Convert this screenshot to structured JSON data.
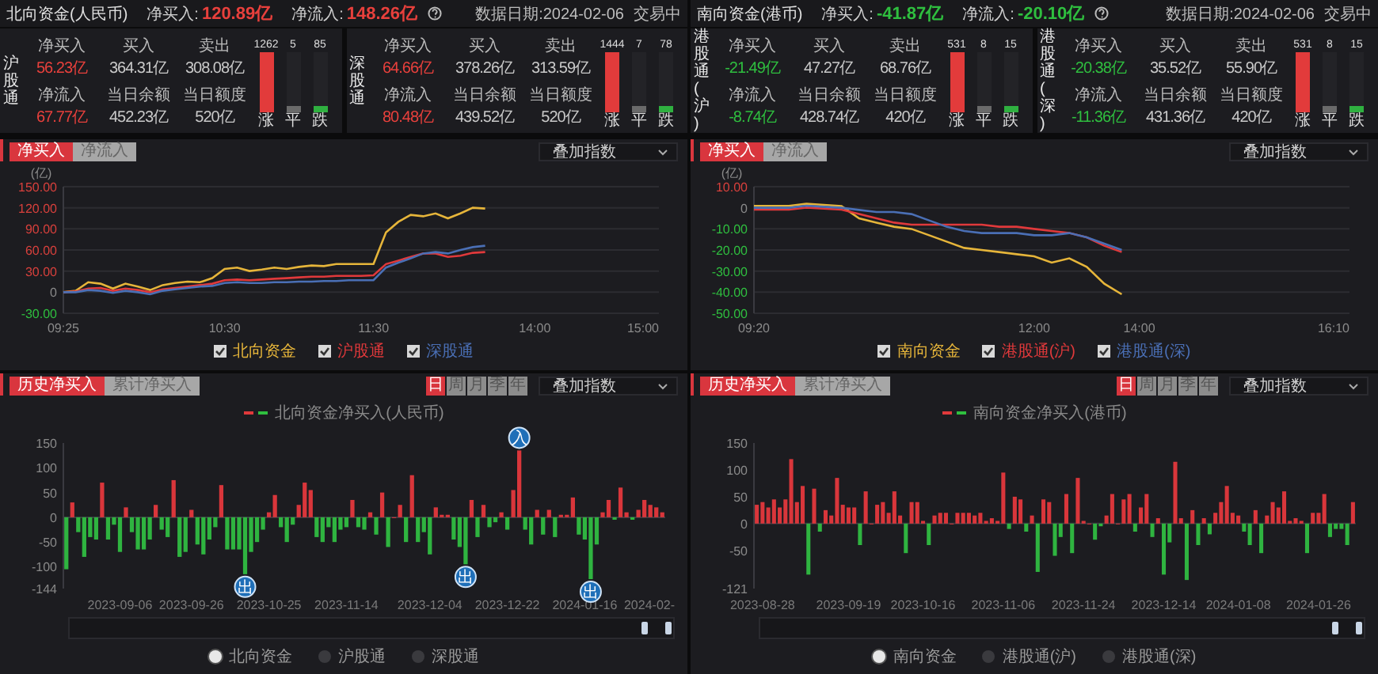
{
  "panels": [
    {
      "header": {
        "title": "北向资金(人民币)",
        "net_buy": {
          "label": "净买入:",
          "value": "120.89亿",
          "color": "#e8403c"
        },
        "net_inflow": {
          "label": "净流入:",
          "value": "148.26亿",
          "color": "#e8403c"
        },
        "date": "数据日期:2024-02-06",
        "status": "交易中"
      },
      "channels": [
        {
          "name": "沪股通",
          "stats": [
            {
              "label": "净买入",
              "value": "56.23亿",
              "color": "#e8403c"
            },
            {
              "label": "买入",
              "value": "364.31亿",
              "color": "#c9c9c9"
            },
            {
              "label": "卖出",
              "value": "308.08亿",
              "color": "#c9c9c9"
            },
            {
              "label": "净流入",
              "value": "67.77亿",
              "color": "#e8403c"
            },
            {
              "label": "当日余额",
              "value": "452.23亿",
              "color": "#c9c9c9"
            },
            {
              "label": "当日额度",
              "value": "520亿",
              "color": "#c9c9c9"
            }
          ],
          "breadth": [
            {
              "kind": "up",
              "count": "1262",
              "label": "涨",
              "level": 1
            },
            {
              "kind": "flat",
              "count": "5",
              "label": "平",
              "level": 0.1
            },
            {
              "kind": "down",
              "count": "85",
              "label": "跌",
              "level": 0.1
            }
          ]
        },
        {
          "name": "深股通",
          "stats": [
            {
              "label": "净买入",
              "value": "64.66亿",
              "color": "#e8403c"
            },
            {
              "label": "买入",
              "value": "378.26亿",
              "color": "#c9c9c9"
            },
            {
              "label": "卖出",
              "value": "313.59亿",
              "color": "#c9c9c9"
            },
            {
              "label": "净流入",
              "value": "80.48亿",
              "color": "#e8403c"
            },
            {
              "label": "当日余额",
              "value": "439.52亿",
              "color": "#c9c9c9"
            },
            {
              "label": "当日额度",
              "value": "520亿",
              "color": "#c9c9c9"
            }
          ],
          "breadth": [
            {
              "kind": "up",
              "count": "1444",
              "label": "涨",
              "level": 1
            },
            {
              "kind": "flat",
              "count": "7",
              "label": "平",
              "level": 0.1
            },
            {
              "kind": "down",
              "count": "78",
              "label": "跌",
              "level": 0.1
            }
          ]
        }
      ],
      "intraday": {
        "tabs": [
          {
            "label": "净买入",
            "selected": true
          },
          {
            "label": "净流入",
            "selected": false
          }
        ],
        "dropdown": "叠加指数",
        "chart_data": {
          "type": "line",
          "ylabel": "(亿)",
          "grid": true,
          "ylim": [
            -30,
            150
          ],
          "categories": [
            "09:25",
            null,
            null,
            null,
            null,
            null,
            null,
            null,
            null,
            null,
            null,
            null,
            null,
            "10:30",
            null,
            null,
            null,
            null,
            null,
            null,
            null,
            null,
            null,
            null,
            null,
            "11:30",
            null,
            null,
            null,
            null,
            null,
            null,
            null,
            null,
            null,
            null,
            null,
            null,
            "14:00",
            null,
            null,
            null,
            null,
            null,
            null,
            null,
            null,
            null,
            "15:00"
          ],
          "yticks": [
            {
              "value": -30,
              "label": "-30.00"
            },
            {
              "value": 0,
              "label": "0"
            },
            {
              "value": 30,
              "label": "30.00"
            },
            {
              "value": 60,
              "label": "60.00"
            },
            {
              "value": 90,
              "label": "90.00"
            },
            {
              "value": 120,
              "label": "120.00"
            },
            {
              "value": 150,
              "label": "150.00"
            }
          ],
          "series": [
            {
              "name": "北向资金",
              "color": "#e6b53a",
              "values": [
                0,
                2,
                14,
                12,
                5,
                12,
                8,
                3,
                10,
                13,
                15,
                14,
                20,
                33,
                35,
                30,
                32,
                35,
                33,
                36,
                38,
                37,
                40,
                40,
                40,
                40,
                85,
                100,
                110,
                108,
                112,
                105,
                112,
                120,
                119,
                null,
                null,
                null,
                null,
                null,
                null,
                null,
                null,
                null,
                null,
                null,
                null,
                null,
                null
              ]
            },
            {
              "name": "沪股通",
              "color": "#e0393b",
              "values": [
                0,
                1,
                5,
                6,
                2,
                5,
                3,
                0,
                4,
                6,
                8,
                10,
                12,
                17,
                18,
                17,
                18,
                19,
                20,
                21,
                22,
                22,
                23,
                23,
                23,
                24,
                40,
                45,
                50,
                55,
                55,
                50,
                52,
                56,
                57,
                null,
                null,
                null,
                null,
                null,
                null,
                null,
                null,
                null,
                null,
                null,
                null,
                null,
                null
              ]
            },
            {
              "name": "深股通",
              "color": "#4a6fb5",
              "values": [
                0,
                0,
                3,
                2,
                -1,
                2,
                0,
                -3,
                2,
                4,
                6,
                8,
                9,
                13,
                14,
                13,
                13,
                14,
                14,
                15,
                15,
                16,
                16,
                17,
                17,
                17,
                35,
                42,
                48,
                55,
                57,
                55,
                60,
                64,
                66,
                null,
                null,
                null,
                null,
                null,
                null,
                null,
                null,
                null,
                null,
                null,
                null,
                null,
                null
              ]
            }
          ]
        },
        "legend": [
          {
            "checked": true
          },
          {
            "checked": true
          },
          {
            "checked": true
          }
        ]
      },
      "history": {
        "tabs": [
          {
            "label": "历史净买入",
            "selected": true
          },
          {
            "label": "累计净买入",
            "selected": false
          }
        ],
        "periods": [
          {
            "label": "日",
            "selected": true
          },
          {
            "label": "周",
            "selected": false
          },
          {
            "label": "月",
            "selected": false
          },
          {
            "label": "季",
            "selected": false
          },
          {
            "label": "年",
            "selected": false
          }
        ],
        "dropdown": "叠加指数",
        "chart_data": {
          "type": "bar",
          "title": "北向资金净买入(人民币)",
          "ylim": [
            -144,
            150
          ],
          "yticks": [
            -144,
            -100,
            -50,
            0,
            50,
            100,
            150
          ],
          "categories": [
            null,
            null,
            null,
            null,
            null,
            null,
            null,
            null,
            null,
            "2023-09-06",
            null,
            null,
            null,
            null,
            null,
            null,
            null,
            null,
            null,
            null,
            null,
            "2023-09-26",
            null,
            null,
            null,
            null,
            null,
            null,
            null,
            null,
            null,
            null,
            null,
            null,
            "2023-10-25",
            null,
            null,
            null,
            null,
            null,
            null,
            null,
            null,
            null,
            null,
            null,
            null,
            "2023-11-14",
            null,
            null,
            null,
            null,
            null,
            null,
            null,
            null,
            null,
            null,
            null,
            null,
            null,
            "2023-12-04",
            null,
            null,
            null,
            null,
            null,
            null,
            null,
            null,
            null,
            null,
            null,
            null,
            "2023-12-22",
            null,
            null,
            null,
            null,
            null,
            null,
            null,
            null,
            null,
            null,
            null,
            null,
            "2024-01-16",
            null,
            null,
            null,
            null,
            null,
            null,
            null,
            null,
            null,
            null,
            "2024-02-",
            null,
            null
          ],
          "values": [
            -105,
            30,
            -30,
            -80,
            -40,
            -45,
            70,
            -45,
            -15,
            -70,
            20,
            -30,
            -65,
            -65,
            -45,
            25,
            -25,
            -40,
            75,
            -80,
            -70,
            15,
            -55,
            -75,
            -45,
            -20,
            65,
            -65,
            -65,
            -65,
            -115,
            -70,
            -50,
            -25,
            10,
            45,
            -20,
            -50,
            -15,
            25,
            70,
            55,
            -40,
            -50,
            -20,
            -50,
            -25,
            -20,
            35,
            -20,
            -25,
            10,
            -35,
            50,
            -60,
            0,
            25,
            -50,
            85,
            -50,
            -30,
            -75,
            20,
            5,
            5,
            -45,
            -60,
            -95,
            35,
            -40,
            25,
            -20,
            -10,
            10,
            -25,
            55,
            135,
            -25,
            -55,
            15,
            -35,
            15,
            -40,
            5,
            5,
            40,
            -35,
            -45,
            -125,
            -55,
            10,
            35,
            -5,
            60,
            10,
            -5,
            15,
            35,
            25,
            20,
            10
          ],
          "annotations": [
            {
              "y": -115,
              "text": "出"
            },
            {
              "y": -95,
              "text": "出"
            },
            {
              "y": 135,
              "text": "入"
            },
            {
              "y": -125,
              "text": "出"
            }
          ]
        },
        "series_options": [
          {
            "label": "北向资金",
            "selected": true
          },
          {
            "label": "沪股通",
            "selected": false
          },
          {
            "label": "深股通",
            "selected": false
          }
        ]
      }
    },
    {
      "header": {
        "title": "南向资金(港币)",
        "net_buy": {
          "label": "净买入:",
          "value": "-41.87亿",
          "color": "#2fbf3f"
        },
        "net_inflow": {
          "label": "净流入:",
          "value": "-20.10亿",
          "color": "#2fbf3f"
        },
        "date": "数据日期:2024-02-06",
        "status": "交易中"
      },
      "channels": [
        {
          "name": "港股通(沪)",
          "stats": [
            {
              "label": "净买入",
              "value": "-21.49亿",
              "color": "#2fbf3f"
            },
            {
              "label": "买入",
              "value": "47.27亿",
              "color": "#c9c9c9"
            },
            {
              "label": "卖出",
              "value": "68.76亿",
              "color": "#c9c9c9"
            },
            {
              "label": "净流入",
              "value": "-8.74亿",
              "color": "#2fbf3f"
            },
            {
              "label": "当日余额",
              "value": "428.74亿",
              "color": "#c9c9c9"
            },
            {
              "label": "当日额度",
              "value": "420亿",
              "color": "#c9c9c9"
            }
          ],
          "breadth": [
            {
              "kind": "up",
              "count": "531",
              "label": "涨",
              "level": 1
            },
            {
              "kind": "flat",
              "count": "8",
              "label": "平",
              "level": 0.1
            },
            {
              "kind": "down",
              "count": "15",
              "label": "跌",
              "level": 0.1
            }
          ]
        },
        {
          "name": "港股通(深)",
          "stats": [
            {
              "label": "净买入",
              "value": "-20.38亿",
              "color": "#2fbf3f"
            },
            {
              "label": "买入",
              "value": "35.52亿",
              "color": "#c9c9c9"
            },
            {
              "label": "卖出",
              "value": "55.90亿",
              "color": "#c9c9c9"
            },
            {
              "label": "净流入",
              "value": "-11.36亿",
              "color": "#2fbf3f"
            },
            {
              "label": "当日余额",
              "value": "431.36亿",
              "color": "#c9c9c9"
            },
            {
              "label": "当日额度",
              "value": "420亿",
              "color": "#c9c9c9"
            }
          ],
          "breadth": [
            {
              "kind": "up",
              "count": "531",
              "label": "涨",
              "level": 1
            },
            {
              "kind": "flat",
              "count": "8",
              "label": "平",
              "level": 0.1
            },
            {
              "kind": "down",
              "count": "15",
              "label": "跌",
              "level": 0.1
            }
          ]
        }
      ],
      "intraday": {
        "tabs": [
          {
            "label": "净买入",
            "selected": true
          },
          {
            "label": "净流入",
            "selected": false
          }
        ],
        "dropdown": "叠加指数",
        "chart_data": {
          "type": "line",
          "ylabel": "(亿)",
          "grid": true,
          "ylim": [
            -50,
            10
          ],
          "categories": [
            "09:20",
            null,
            null,
            null,
            null,
            null,
            null,
            null,
            null,
            null,
            null,
            null,
            null,
            null,
            null,
            null,
            "12:00",
            null,
            null,
            null,
            null,
            null,
            "14:00",
            null,
            null,
            null,
            null,
            null,
            null,
            null,
            null,
            null,
            null,
            null,
            "16:10"
          ],
          "yticks": [
            {
              "value": -50,
              "label": "-50.00"
            },
            {
              "value": -40,
              "label": "-40.00"
            },
            {
              "value": -30,
              "label": "-30.00"
            },
            {
              "value": -20,
              "label": "-20.00"
            },
            {
              "value": -10,
              "label": "-10.00"
            },
            {
              "value": 0,
              "label": "0"
            },
            {
              "value": 10,
              "label": "10.00"
            }
          ],
          "series": [
            {
              "name": "南向资金",
              "color": "#e6b53a",
              "values": [
                0.9,
                0.9,
                0.9,
                1.9,
                1.4,
                0.8,
                -5,
                -7,
                -9,
                -10,
                -13,
                -16,
                -19,
                -20,
                -21,
                -22,
                -23,
                -26,
                -24,
                -28,
                -36,
                -41,
                null,
                null,
                null,
                null,
                null,
                null,
                null,
                null,
                null,
                null,
                null,
                null,
                null
              ]
            },
            {
              "name": "港股通(沪)",
              "color": "#e0393b",
              "values": [
                -0.9,
                -0.9,
                -0.9,
                0.1,
                -0.4,
                -0.9,
                -3,
                -5,
                -7,
                -8,
                -8,
                -8,
                -8,
                -8,
                -9,
                -9,
                -10,
                -11,
                -12,
                -14,
                -18,
                -21,
                null,
                null,
                null,
                null,
                null,
                null,
                null,
                null,
                null,
                null,
                null,
                null,
                null
              ]
            },
            {
              "name": "港股通(深)",
              "color": "#4a6fb5",
              "values": [
                0,
                0,
                0,
                1,
                0.5,
                0,
                -1,
                -2,
                -2,
                -3,
                -6,
                -9,
                -11,
                -12,
                -12,
                -12,
                -13,
                -13,
                -12,
                -14,
                -17,
                -20,
                null,
                null,
                null,
                null,
                null,
                null,
                null,
                null,
                null,
                null,
                null,
                null,
                null
              ]
            }
          ]
        },
        "legend": [
          {
            "checked": true
          },
          {
            "checked": true
          },
          {
            "checked": true
          }
        ]
      },
      "history": {
        "tabs": [
          {
            "label": "历史净买入",
            "selected": true
          },
          {
            "label": "累计净买入",
            "selected": false
          }
        ],
        "periods": [
          {
            "label": "日",
            "selected": true
          },
          {
            "label": "周",
            "selected": false
          },
          {
            "label": "月",
            "selected": false
          },
          {
            "label": "季",
            "selected": false
          },
          {
            "label": "年",
            "selected": false
          }
        ],
        "dropdown": "叠加指数",
        "chart_data": {
          "type": "bar",
          "title": "南向资金净买入(港币)",
          "ylim": [
            -121,
            150
          ],
          "yticks": [
            -121,
            -50,
            0,
            50,
            100,
            150
          ],
          "categories": [
            null,
            "2023-08-28",
            null,
            null,
            null,
            null,
            null,
            null,
            null,
            null,
            null,
            null,
            null,
            null,
            null,
            null,
            "2023-09-19",
            null,
            null,
            null,
            null,
            null,
            null,
            null,
            null,
            null,
            null,
            null,
            null,
            "2023-10-16",
            null,
            null,
            null,
            null,
            null,
            null,
            null,
            null,
            null,
            null,
            null,
            null,
            null,
            "2023-11-06",
            null,
            null,
            null,
            null,
            null,
            null,
            null,
            null,
            null,
            null,
            null,
            null,
            null,
            "2023-11-24",
            null,
            null,
            null,
            null,
            null,
            null,
            null,
            null,
            null,
            null,
            null,
            null,
            null,
            "2023-12-14",
            null,
            null,
            null,
            null,
            null,
            null,
            null,
            null,
            null,
            null,
            null,
            null,
            "2024-01-08",
            null,
            null,
            null,
            null,
            null,
            null,
            null,
            null,
            null,
            null,
            null,
            null,
            null,
            "2024-01-26",
            null,
            null,
            null,
            null,
            null,
            null
          ],
          "values": [
            35,
            40,
            30,
            45,
            30,
            45,
            120,
            40,
            70,
            -95,
            65,
            -15,
            25,
            15,
            85,
            35,
            30,
            30,
            -40,
            60,
            0,
            35,
            40,
            20,
            60,
            15,
            -55,
            40,
            40,
            5,
            -40,
            15,
            20,
            20,
            0,
            20,
            20,
            20,
            15,
            20,
            5,
            10,
            5,
            95,
            -10,
            50,
            45,
            -15,
            15,
            -90,
            45,
            40,
            -60,
            -25,
            55,
            -55,
            85,
            5,
            0,
            -30,
            -5,
            15,
            55,
            0,
            45,
            55,
            -15,
            30,
            55,
            -25,
            10,
            -95,
            -35,
            115,
            10,
            -105,
            25,
            -40,
            10,
            -20,
            20,
            40,
            70,
            20,
            15,
            -15,
            -40,
            25,
            -55,
            15,
            40,
            30,
            60,
            5,
            10,
            5,
            -55,
            20,
            20,
            55,
            -25,
            -10,
            -10,
            -40,
            40
          ]
        },
        "series_options": [
          {
            "label": "南向资金",
            "selected": true
          },
          {
            "label": "港股通(沪)",
            "selected": false
          },
          {
            "label": "港股通(深)",
            "selected": false
          }
        ]
      }
    }
  ]
}
